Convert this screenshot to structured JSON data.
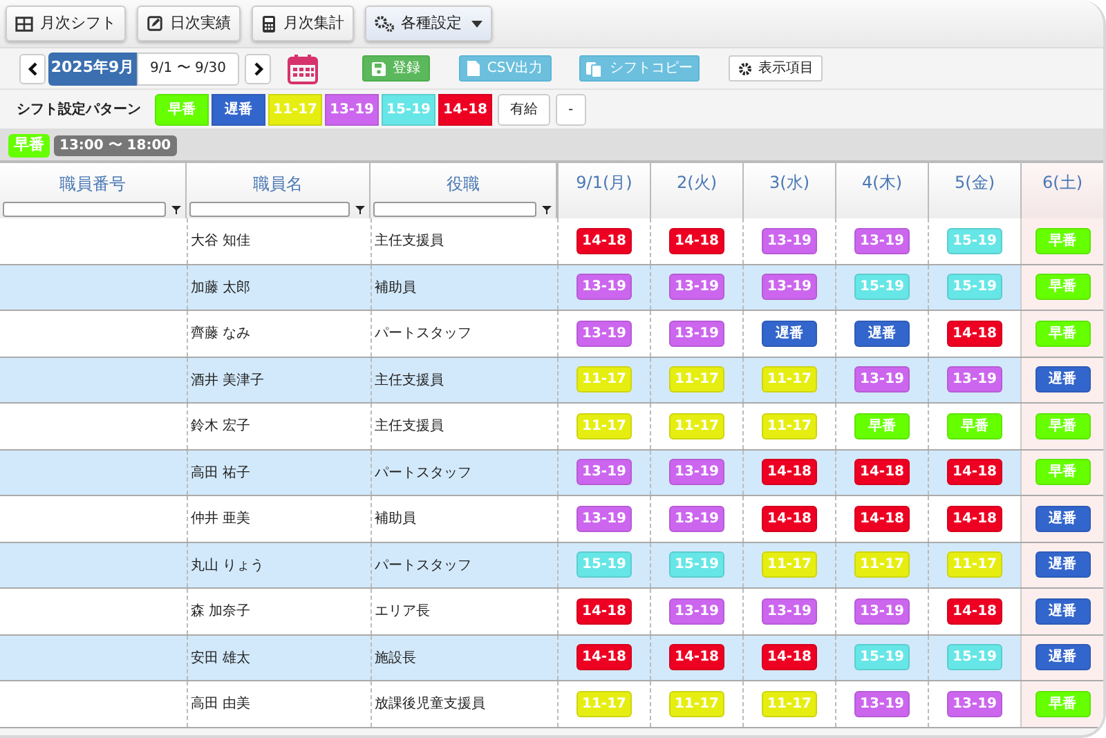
{
  "toolbar": [
    {
      "label": "月次シフト",
      "dropdown": false
    },
    {
      "label": "日次実績",
      "dropdown": false
    },
    {
      "label": "月次集計",
      "dropdown": false
    },
    {
      "label": "各種設定",
      "dropdown": true
    }
  ],
  "period": {
    "month": "2025年9月",
    "range": "9/1 〜 9/30"
  },
  "actions": [
    {
      "label": "登録",
      "kind": "save"
    },
    {
      "label": "CSV出力",
      "kind": "csv"
    },
    {
      "label": "シフトコピー",
      "kind": "copy"
    },
    {
      "label": "表示項目",
      "kind": "display"
    }
  ],
  "patterns": {
    "label": "シフト設定パターン",
    "items": [
      {
        "label": "早番",
        "kind": "shift",
        "color": "#66ff00"
      },
      {
        "label": "遅番",
        "kind": "shift",
        "color": "#3366cc"
      },
      {
        "label": "11-17",
        "kind": "shift",
        "color": "#e6ee11"
      },
      {
        "label": "13-19",
        "kind": "shift",
        "color": "#cc66ee"
      },
      {
        "label": "15-19",
        "kind": "shift",
        "color": "#66e6e6"
      },
      {
        "label": "14-18",
        "kind": "shift",
        "color": "#ee0022"
      },
      {
        "label": "有給",
        "kind": "plain"
      },
      {
        "label": "-",
        "kind": "plain"
      }
    ]
  },
  "current_pattern": {
    "label": "早番",
    "color": "#66ff00",
    "time": "13:00 〜 18:00"
  },
  "table": {
    "columns": [
      {
        "label": "職員番号"
      },
      {
        "label": "職員名"
      },
      {
        "label": "役職"
      }
    ],
    "days": [
      {
        "label": "9/1(月)",
        "holiday": false
      },
      {
        "label": "2(火)",
        "holiday": false
      },
      {
        "label": "3(水)",
        "holiday": false
      },
      {
        "label": "4(木)",
        "holiday": false
      },
      {
        "label": "5(金)",
        "holiday": false
      },
      {
        "label": "6(土)",
        "holiday": true
      }
    ],
    "rows": [
      {
        "name": "大谷 知佳",
        "role": "主任支援員",
        "shifts": [
          {
            "label": "14-18",
            "color": "#ee0022"
          },
          {
            "label": "14-18",
            "color": "#ee0022"
          },
          {
            "label": "13-19",
            "color": "#cc66ee"
          },
          {
            "label": "13-19",
            "color": "#cc66ee"
          },
          {
            "label": "15-19",
            "color": "#66e6e6"
          },
          {
            "label": "早番",
            "color": "#66ff00"
          }
        ]
      },
      {
        "name": "加藤 太郎",
        "role": "補助員",
        "shifts": [
          {
            "label": "13-19",
            "color": "#cc66ee"
          },
          {
            "label": "13-19",
            "color": "#cc66ee"
          },
          {
            "label": "13-19",
            "color": "#cc66ee"
          },
          {
            "label": "15-19",
            "color": "#66e6e6"
          },
          {
            "label": "15-19",
            "color": "#66e6e6"
          },
          {
            "label": "早番",
            "color": "#66ff00"
          }
        ]
      },
      {
        "name": "齊藤 なみ",
        "role": "パートスタッフ",
        "shifts": [
          {
            "label": "13-19",
            "color": "#cc66ee"
          },
          {
            "label": "13-19",
            "color": "#cc66ee"
          },
          {
            "label": "遅番",
            "color": "#3366cc"
          },
          {
            "label": "遅番",
            "color": "#3366cc"
          },
          {
            "label": "14-18",
            "color": "#ee0022"
          },
          {
            "label": "早番",
            "color": "#66ff00"
          }
        ]
      },
      {
        "name": "酒井 美津子",
        "role": "主任支援員",
        "shifts": [
          {
            "label": "11-17",
            "color": "#e6ee11"
          },
          {
            "label": "11-17",
            "color": "#e6ee11"
          },
          {
            "label": "11-17",
            "color": "#e6ee11"
          },
          {
            "label": "13-19",
            "color": "#cc66ee"
          },
          {
            "label": "13-19",
            "color": "#cc66ee"
          },
          {
            "label": "遅番",
            "color": "#3366cc"
          }
        ]
      },
      {
        "name": "鈴木 宏子",
        "role": "主任支援員",
        "shifts": [
          {
            "label": "11-17",
            "color": "#e6ee11"
          },
          {
            "label": "11-17",
            "color": "#e6ee11"
          },
          {
            "label": "11-17",
            "color": "#e6ee11"
          },
          {
            "label": "早番",
            "color": "#66ff00"
          },
          {
            "label": "早番",
            "color": "#66ff00"
          },
          {
            "label": "早番",
            "color": "#66ff00"
          }
        ]
      },
      {
        "name": "高田 祐子",
        "role": "パートスタッフ",
        "shifts": [
          {
            "label": "13-19",
            "color": "#cc66ee"
          },
          {
            "label": "13-19",
            "color": "#cc66ee"
          },
          {
            "label": "14-18",
            "color": "#ee0022"
          },
          {
            "label": "14-18",
            "color": "#ee0022"
          },
          {
            "label": "14-18",
            "color": "#ee0022"
          },
          {
            "label": "早番",
            "color": "#66ff00"
          }
        ]
      },
      {
        "name": "仲井 亜美",
        "role": "補助員",
        "shifts": [
          {
            "label": "13-19",
            "color": "#cc66ee"
          },
          {
            "label": "13-19",
            "color": "#cc66ee"
          },
          {
            "label": "14-18",
            "color": "#ee0022"
          },
          {
            "label": "14-18",
            "color": "#ee0022"
          },
          {
            "label": "14-18",
            "color": "#ee0022"
          },
          {
            "label": "遅番",
            "color": "#3366cc"
          }
        ]
      },
      {
        "name": "丸山 りょう",
        "role": "パートスタッフ",
        "shifts": [
          {
            "label": "15-19",
            "color": "#66e6e6"
          },
          {
            "label": "15-19",
            "color": "#66e6e6"
          },
          {
            "label": "11-17",
            "color": "#e6ee11"
          },
          {
            "label": "11-17",
            "color": "#e6ee11"
          },
          {
            "label": "11-17",
            "color": "#e6ee11"
          },
          {
            "label": "遅番",
            "color": "#3366cc"
          }
        ]
      },
      {
        "name": "森 加奈子",
        "role": "エリア長",
        "shifts": [
          {
            "label": "14-18",
            "color": "#ee0022"
          },
          {
            "label": "13-19",
            "color": "#cc66ee"
          },
          {
            "label": "13-19",
            "color": "#cc66ee"
          },
          {
            "label": "13-19",
            "color": "#cc66ee"
          },
          {
            "label": "14-18",
            "color": "#ee0022"
          },
          {
            "label": "遅番",
            "color": "#3366cc"
          }
        ]
      },
      {
        "name": "安田 雄太",
        "role": "施設長",
        "shifts": [
          {
            "label": "14-18",
            "color": "#ee0022"
          },
          {
            "label": "14-18",
            "color": "#ee0022"
          },
          {
            "label": "14-18",
            "color": "#ee0022"
          },
          {
            "label": "15-19",
            "color": "#66e6e6"
          },
          {
            "label": "15-19",
            "color": "#66e6e6"
          },
          {
            "label": "遅番",
            "color": "#3366cc"
          }
        ]
      },
      {
        "name": "高田 由美",
        "role": "放課後児童支援員",
        "shifts": [
          {
            "label": "11-17",
            "color": "#e6ee11"
          },
          {
            "label": "11-17",
            "color": "#e6ee11"
          },
          {
            "label": "11-17",
            "color": "#e6ee11"
          },
          {
            "label": "13-19",
            "color": "#cc66ee"
          },
          {
            "label": "13-19",
            "color": "#cc66ee"
          },
          {
            "label": "早番",
            "color": "#66ff00"
          }
        ]
      }
    ]
  }
}
